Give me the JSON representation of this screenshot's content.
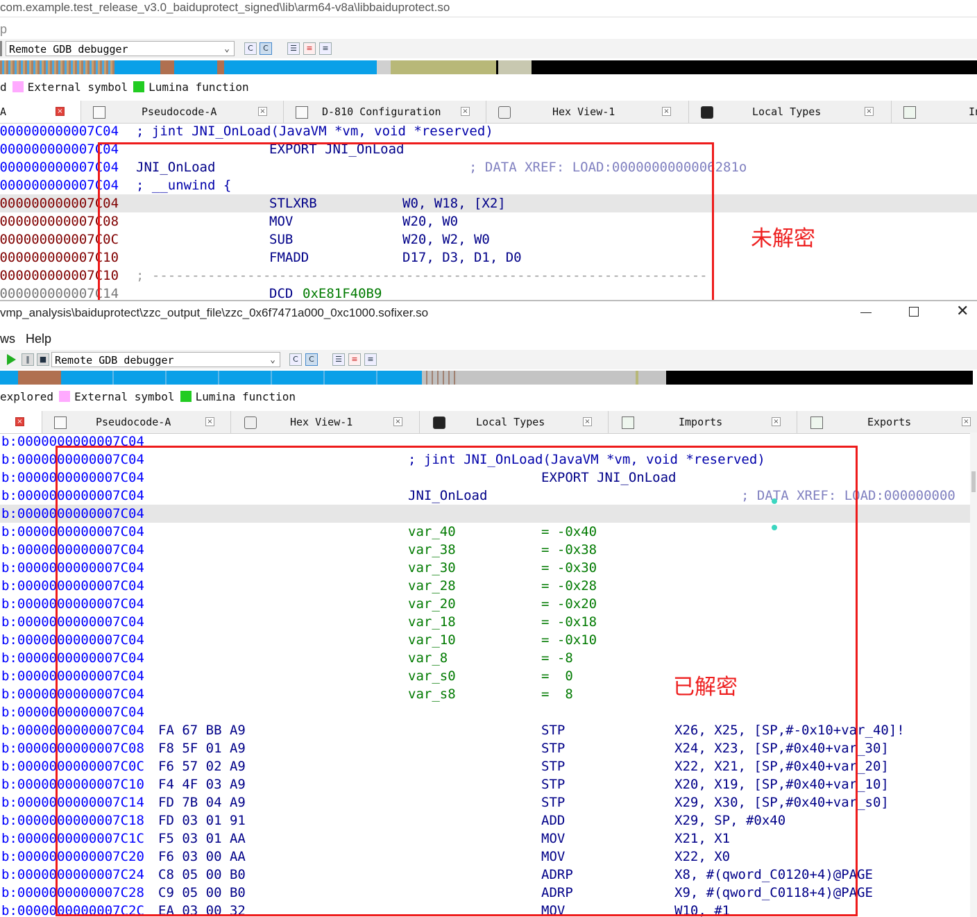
{
  "top": {
    "title": "com.example.test_release_v3.0_baiduprotect_signed\\lib\\arm64-v8a\\libbaiduprotect.so",
    "menu_fragment": "p",
    "debugger": "Remote GDB debugger",
    "legend": [
      {
        "prefix": "d",
        "label": "External symbol",
        "color": "#ffaaff"
      },
      {
        "label": "Lumina function",
        "color": "#22cc22"
      }
    ],
    "tabs": [
      {
        "label": "A"
      },
      {
        "label": "Pseudocode-A"
      },
      {
        "label": "D-810 Configuration"
      },
      {
        "label": "Hex View-1"
      },
      {
        "label": "Local Types"
      },
      {
        "label": "In"
      }
    ],
    "lines": [
      {
        "addr": "0000000000007C04",
        "a": "; jint JNI_OnLoad(JavaVM *vm, void *reserved)"
      },
      {
        "addr": "0000000000007C04",
        "m": "EXPORT JNI_OnLoad"
      },
      {
        "addr": "0000000000007C04",
        "a": "JNI_OnLoad",
        "cmt": "; DATA XREF: LOAD:0000000000006281o"
      },
      {
        "addr": "0000000000007C04",
        "a": "; __unwind {"
      },
      {
        "addr": "0000000000007C04",
        "m": "STLXRB",
        "o": "W0, W18, [X2]"
      },
      {
        "addr": "0000000000007C08",
        "m": "MOV",
        "o": "W20, W0"
      },
      {
        "addr": "0000000000007C0C",
        "m": "SUB",
        "o": "W20, W2, W0"
      },
      {
        "addr": "0000000000007C10",
        "m": "FMADD",
        "o": "D17, D3, D1, D0"
      },
      {
        "addr": "0000000000007C10",
        "sep": "; ----------------------------------------------------------------------"
      },
      {
        "addr": "0000000000007C14",
        "m": "DCD",
        "o": "0xE81F40B9"
      }
    ],
    "annotation": "未解密"
  },
  "bottom": {
    "title": "vmp_analysis\\baiduprotect\\zzc_output_file\\zzc_0x6f7471a000_0xc1000.sofixer.so",
    "menu": [
      "ws",
      "Help"
    ],
    "debugger": "Remote GDB debugger",
    "legend": [
      {
        "prefix": "explored",
        "label": "External symbol",
        "color": "#ffaaff"
      },
      {
        "label": "Lumina function",
        "color": "#22cc22"
      }
    ],
    "tabs": [
      {
        "label": ""
      },
      {
        "label": "Pseudocode-A"
      },
      {
        "label": "Hex View-1"
      },
      {
        "label": "Local Types"
      },
      {
        "label": "Imports"
      },
      {
        "label": "Exports"
      }
    ],
    "lines": [
      {
        "addr": "b:0000000000007C04"
      },
      {
        "addr": "b:0000000000007C04",
        "lbl": "; jint JNI_OnLoad(JavaVM *vm, void *reserved)"
      },
      {
        "addr": "b:0000000000007C04",
        "m": "EXPORT JNI_OnLoad"
      },
      {
        "addr": "b:0000000000007C04",
        "lbl": "JNI_OnLoad",
        "cmt": "; DATA XREF: LOAD:000000000"
      },
      {
        "addr": "b:0000000000007C04"
      },
      {
        "addr": "b:0000000000007C04",
        "var": "var_40",
        "val": "= -0x40"
      },
      {
        "addr": "b:0000000000007C04",
        "var": "var_38",
        "val": "= -0x38"
      },
      {
        "addr": "b:0000000000007C04",
        "var": "var_30",
        "val": "= -0x30"
      },
      {
        "addr": "b:0000000000007C04",
        "var": "var_28",
        "val": "= -0x28"
      },
      {
        "addr": "b:0000000000007C04",
        "var": "var_20",
        "val": "= -0x20"
      },
      {
        "addr": "b:0000000000007C04",
        "var": "var_18",
        "val": "= -0x18"
      },
      {
        "addr": "b:0000000000007C04",
        "var": "var_10",
        "val": "= -0x10"
      },
      {
        "addr": "b:0000000000007C04",
        "var": "var_8",
        "val": "= -8"
      },
      {
        "addr": "b:0000000000007C04",
        "var": "var_s0",
        "val": "=  0"
      },
      {
        "addr": "b:0000000000007C04",
        "var": "var_s8",
        "val": "=  8"
      },
      {
        "addr": "b:0000000000007C04"
      },
      {
        "addr": "b:0000000000007C04",
        "bytes": "FA 67 BB A9",
        "m": "STP",
        "o": "X26, X25, [SP,#-0x10+var_40]!"
      },
      {
        "addr": "b:0000000000007C08",
        "bytes": "F8 5F 01 A9",
        "m": "STP",
        "o": "X24, X23, [SP,#0x40+var_30]"
      },
      {
        "addr": "b:0000000000007C0C",
        "bytes": "F6 57 02 A9",
        "m": "STP",
        "o": "X22, X21, [SP,#0x40+var_20]"
      },
      {
        "addr": "b:0000000000007C10",
        "bytes": "F4 4F 03 A9",
        "m": "STP",
        "o": "X20, X19, [SP,#0x40+var_10]"
      },
      {
        "addr": "b:0000000000007C14",
        "bytes": "FD 7B 04 A9",
        "m": "STP",
        "o": "X29, X30, [SP,#0x40+var_s0]"
      },
      {
        "addr": "b:0000000000007C18",
        "bytes": "FD 03 01 91",
        "m": "ADD",
        "o": "X29, SP, #0x40"
      },
      {
        "addr": "b:0000000000007C1C",
        "bytes": "F5 03 01 AA",
        "m": "MOV",
        "o": "X21, X1"
      },
      {
        "addr": "b:0000000000007C20",
        "bytes": "F6 03 00 AA",
        "m": "MOV",
        "o": "X22, X0"
      },
      {
        "addr": "b:0000000000007C24",
        "bytes": "C8 05 00 B0",
        "m": "ADRP",
        "o": "X8, #(qword_C0120+4)@PAGE"
      },
      {
        "addr": "b:0000000000007C28",
        "bytes": "C9 05 00 B0",
        "m": "ADRP",
        "o": "X9, #(qword_C0118+4)@PAGE"
      },
      {
        "addr": "b:0000000000007C2C",
        "bytes": "EA 03 00 32",
        "m": "MOV",
        "o": "W10, #1"
      }
    ],
    "annotation": "已解密"
  },
  "icons": {
    "minimize": "minimize-icon",
    "maximize": "maximize-icon",
    "close": "close-icon",
    "run": "play-icon"
  }
}
